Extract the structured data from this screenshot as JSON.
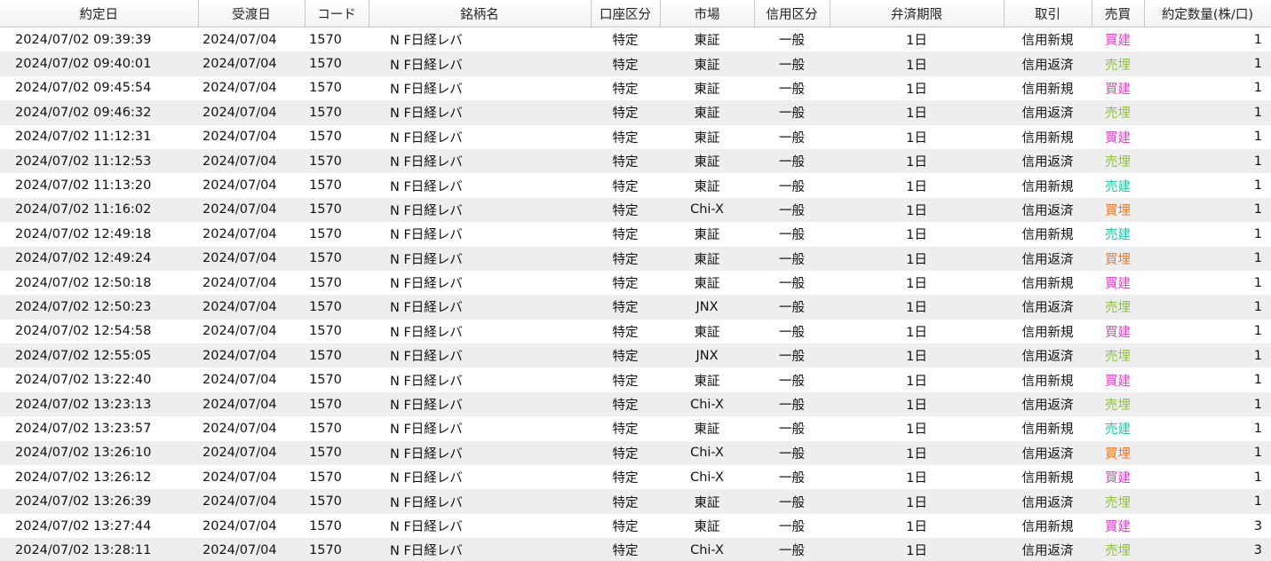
{
  "table": {
    "columns": [
      "約定日",
      "受渡日",
      "コード",
      "銘柄名",
      "口座区分",
      "市場",
      "信用区分",
      "弁済期限",
      "取引",
      "売買",
      "約定数量(株/口)"
    ],
    "rows": [
      [
        "2024/07/02 09:39:39",
        "2024/07/04",
        "1570",
        "N F日経レバ",
        "特定",
        "東証",
        "一般",
        "1日",
        "信用新規",
        "買建",
        "1"
      ],
      [
        "2024/07/02 09:40:01",
        "2024/07/04",
        "1570",
        "N F日経レバ",
        "特定",
        "東証",
        "一般",
        "1日",
        "信用返済",
        "売埋",
        "1"
      ],
      [
        "2024/07/02 09:45:54",
        "2024/07/04",
        "1570",
        "N F日経レバ",
        "特定",
        "東証",
        "一般",
        "1日",
        "信用新規",
        "買建",
        "1"
      ],
      [
        "2024/07/02 09:46:32",
        "2024/07/04",
        "1570",
        "N F日経レバ",
        "特定",
        "東証",
        "一般",
        "1日",
        "信用返済",
        "売埋",
        "1"
      ],
      [
        "2024/07/02 11:12:31",
        "2024/07/04",
        "1570",
        "N F日経レバ",
        "特定",
        "東証",
        "一般",
        "1日",
        "信用新規",
        "買建",
        "1"
      ],
      [
        "2024/07/02 11:12:53",
        "2024/07/04",
        "1570",
        "N F日経レバ",
        "特定",
        "東証",
        "一般",
        "1日",
        "信用返済",
        "売埋",
        "1"
      ],
      [
        "2024/07/02 11:13:20",
        "2024/07/04",
        "1570",
        "N F日経レバ",
        "特定",
        "東証",
        "一般",
        "1日",
        "信用新規",
        "売建",
        "1"
      ],
      [
        "2024/07/02 11:16:02",
        "2024/07/04",
        "1570",
        "N F日経レバ",
        "特定",
        "Chi-X",
        "一般",
        "1日",
        "信用返済",
        "買埋",
        "1"
      ],
      [
        "2024/07/02 12:49:18",
        "2024/07/04",
        "1570",
        "N F日経レバ",
        "特定",
        "東証",
        "一般",
        "1日",
        "信用新規",
        "売建",
        "1"
      ],
      [
        "2024/07/02 12:49:24",
        "2024/07/04",
        "1570",
        "N F日経レバ",
        "特定",
        "東証",
        "一般",
        "1日",
        "信用返済",
        "買埋",
        "1"
      ],
      [
        "2024/07/02 12:50:18",
        "2024/07/04",
        "1570",
        "N F日経レバ",
        "特定",
        "東証",
        "一般",
        "1日",
        "信用新規",
        "買建",
        "1"
      ],
      [
        "2024/07/02 12:50:23",
        "2024/07/04",
        "1570",
        "N F日経レバ",
        "特定",
        "JNX",
        "一般",
        "1日",
        "信用返済",
        "売埋",
        "1"
      ],
      [
        "2024/07/02 12:54:58",
        "2024/07/04",
        "1570",
        "N F日経レバ",
        "特定",
        "東証",
        "一般",
        "1日",
        "信用新規",
        "買建",
        "1"
      ],
      [
        "2024/07/02 12:55:05",
        "2024/07/04",
        "1570",
        "N F日経レバ",
        "特定",
        "JNX",
        "一般",
        "1日",
        "信用返済",
        "売埋",
        "1"
      ],
      [
        "2024/07/02 13:22:40",
        "2024/07/04",
        "1570",
        "N F日経レバ",
        "特定",
        "東証",
        "一般",
        "1日",
        "信用新規",
        "買建",
        "1"
      ],
      [
        "2024/07/02 13:23:13",
        "2024/07/04",
        "1570",
        "N F日経レバ",
        "特定",
        "Chi-X",
        "一般",
        "1日",
        "信用返済",
        "売埋",
        "1"
      ],
      [
        "2024/07/02 13:23:57",
        "2024/07/04",
        "1570",
        "N F日経レバ",
        "特定",
        "東証",
        "一般",
        "1日",
        "信用新規",
        "売建",
        "1"
      ],
      [
        "2024/07/02 13:26:10",
        "2024/07/04",
        "1570",
        "N F日経レバ",
        "特定",
        "Chi-X",
        "一般",
        "1日",
        "信用返済",
        "買埋",
        "1"
      ],
      [
        "2024/07/02 13:26:12",
        "2024/07/04",
        "1570",
        "N F日経レバ",
        "特定",
        "Chi-X",
        "一般",
        "1日",
        "信用新規",
        "買建",
        "1"
      ],
      [
        "2024/07/02 13:26:39",
        "2024/07/04",
        "1570",
        "N F日経レバ",
        "特定",
        "東証",
        "一般",
        "1日",
        "信用返済",
        "売埋",
        "1"
      ],
      [
        "2024/07/02 13:27:44",
        "2024/07/04",
        "1570",
        "N F日経レバ",
        "特定",
        "東証",
        "一般",
        "1日",
        "信用新規",
        "買建",
        "3"
      ],
      [
        "2024/07/02 13:28:11",
        "2024/07/04",
        "1570",
        "N F日経レバ",
        "特定",
        "Chi-X",
        "一般",
        "1日",
        "信用返済",
        "売埋",
        "3"
      ]
    ]
  },
  "trade_side_colors": {
    "買建": "#e040c8",
    "売埋": "#8cc23c",
    "売建": "#1cc8a8",
    "買埋": "#f07828"
  }
}
